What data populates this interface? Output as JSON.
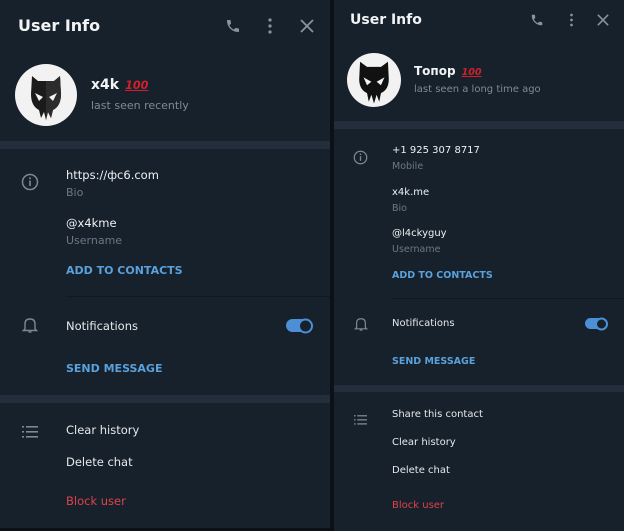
{
  "left": {
    "header": {
      "title": "User Info",
      "icons": [
        "phone-icon",
        "more-vertical-icon",
        "close-icon"
      ]
    },
    "profile": {
      "name": "x4k",
      "emoji": "💯",
      "status": "last seen recently"
    },
    "info": [
      {
        "value": "https://фс6.com",
        "label": "Bio"
      },
      {
        "value": "@x4kme",
        "label": "Username"
      }
    ],
    "add_contact_label": "ADD TO CONTACTS",
    "notifications": {
      "label": "Notifications",
      "enabled": true
    },
    "send_message_label": "SEND MESSAGE",
    "actions": [
      {
        "label": "Clear history",
        "danger": false
      },
      {
        "label": "Delete chat",
        "danger": false
      },
      {
        "label": "Block user",
        "danger": true
      }
    ]
  },
  "right": {
    "header": {
      "title": "User Info",
      "icons": [
        "phone-icon",
        "more-vertical-icon",
        "close-icon"
      ]
    },
    "profile": {
      "name": "Топор",
      "emoji": "💯",
      "status": "last seen a long time ago"
    },
    "info": [
      {
        "value": "+1 925 307 8717",
        "label": "Mobile"
      },
      {
        "value": "x4k.me",
        "label": "Bio"
      },
      {
        "value": "@l4ckyguy",
        "label": "Username"
      }
    ],
    "add_contact_label": "ADD TO CONTACTS",
    "notifications": {
      "label": "Notifications",
      "enabled": true
    },
    "send_message_label": "SEND MESSAGE",
    "actions": [
      {
        "label": "Share this contact",
        "danger": false
      },
      {
        "label": "Clear history",
        "danger": false
      },
      {
        "label": "Delete chat",
        "danger": false
      },
      {
        "label": "Block user",
        "danger": true
      }
    ]
  },
  "colors": {
    "panel_bg": "#17212b",
    "accent": "#5aa1dc",
    "toggle": "#4d8fd6",
    "danger": "#e0414b"
  }
}
